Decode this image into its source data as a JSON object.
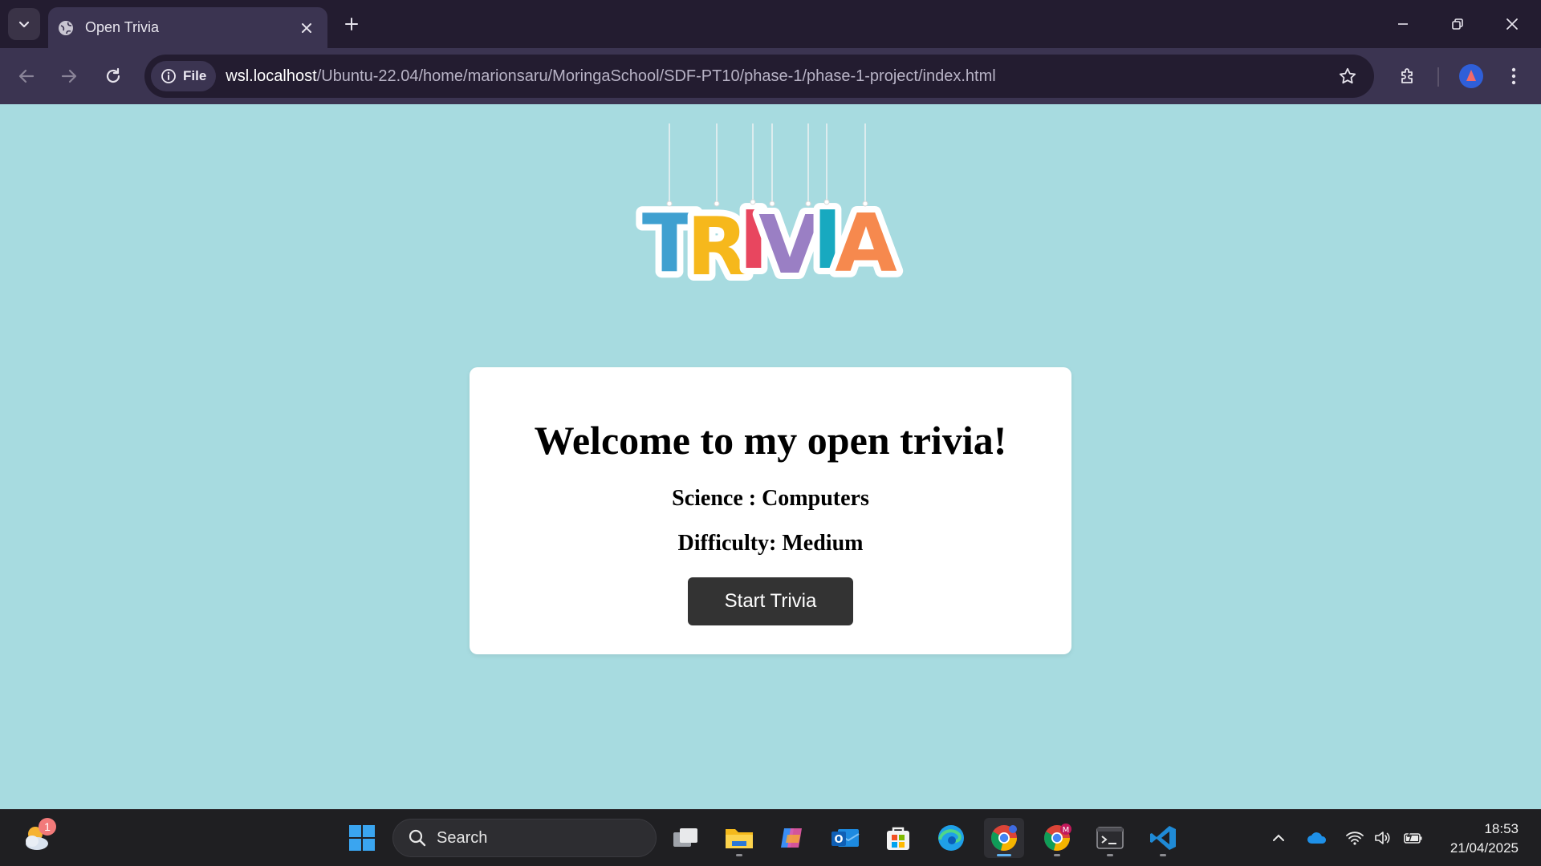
{
  "browser": {
    "tab_title": "Open Trivia",
    "security_chip": "File",
    "url_host": "wsl.localhost",
    "url_path": "/Ubuntu-22.04/home/marionsaru/MoringaSchool/SDF-PT10/phase-1/phase-1-project/index.html"
  },
  "page": {
    "logo_text": "TRIVIA",
    "logo_letter_colors": [
      "#3fa0d0",
      "#f6b81c",
      "#e8465f",
      "#9a7fc4",
      "#18a9c0",
      "#f6894e"
    ],
    "title": "Welcome to my open trivia!",
    "category": "Science : Computers",
    "difficulty": "Difficulty: Medium",
    "start_button": "Start Trivia"
  },
  "taskbar": {
    "weather_badge": "1",
    "search_placeholder": "Search",
    "chrome_profile_badge": "M",
    "time": "18:53",
    "date": "21/04/2025"
  },
  "colors": {
    "page_background": "#a7dbe0",
    "button_background": "#333333",
    "browser_frame": "#231c30",
    "browser_toolbar": "#3b3451"
  }
}
